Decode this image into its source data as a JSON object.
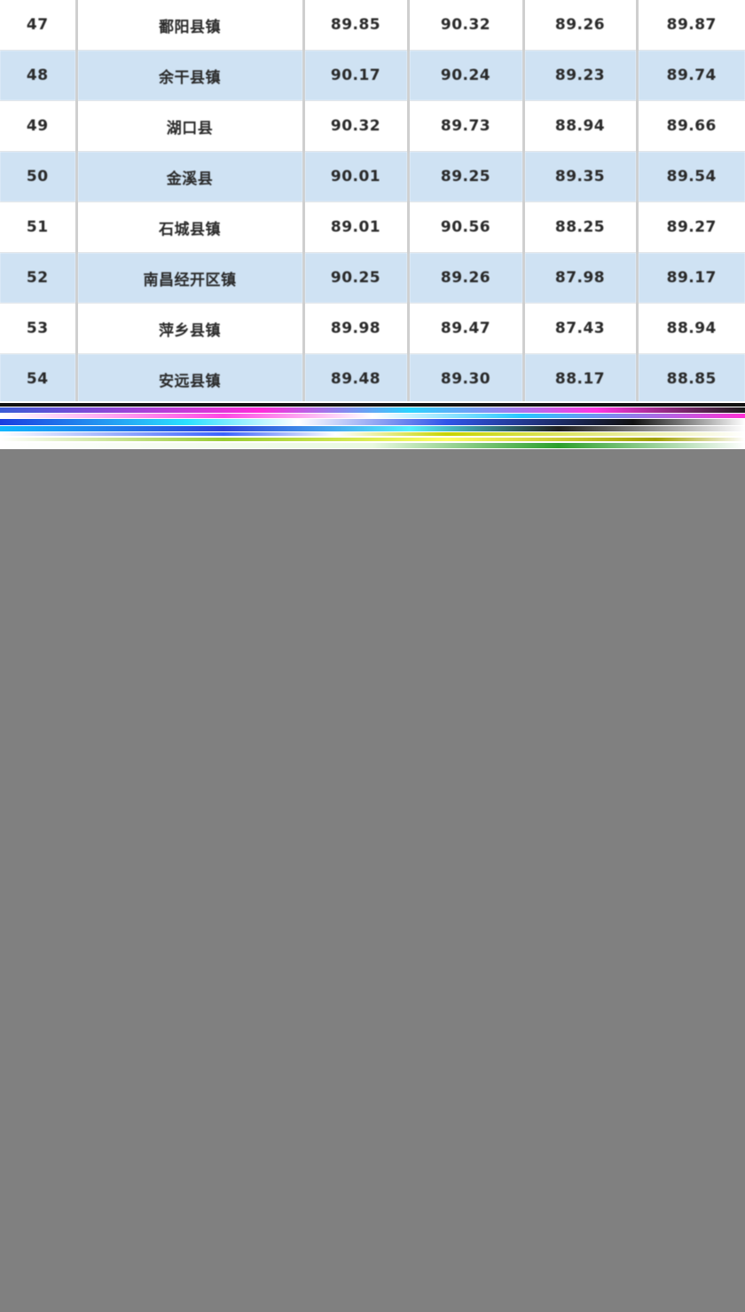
{
  "table": {
    "rows": [
      {
        "rank": "47",
        "name": "鄱阳县镇",
        "v1": "89.85",
        "v2": "90.32",
        "v3": "89.26",
        "v4": "89.87"
      },
      {
        "rank": "48",
        "name": "余干县镇",
        "v1": "90.17",
        "v2": "90.24",
        "v3": "89.23",
        "v4": "89.74"
      },
      {
        "rank": "49",
        "name": "湖口县",
        "v1": "90.32",
        "v2": "89.73",
        "v3": "88.94",
        "v4": "89.66"
      },
      {
        "rank": "50",
        "name": "金溪县",
        "v1": "90.01",
        "v2": "89.25",
        "v3": "89.35",
        "v4": "89.54"
      },
      {
        "rank": "51",
        "name": "石城县镇",
        "v1": "89.01",
        "v2": "90.56",
        "v3": "88.25",
        "v4": "89.27"
      },
      {
        "rank": "52",
        "name": "南昌经开区镇",
        "v1": "90.25",
        "v2": "89.26",
        "v3": "87.98",
        "v4": "89.17"
      },
      {
        "rank": "53",
        "name": "萍乡县镇",
        "v1": "89.98",
        "v2": "89.47",
        "v3": "87.43",
        "v4": "88.94"
      },
      {
        "rank": "54",
        "name": "安远县镇",
        "v1": "89.48",
        "v2": "89.30",
        "v3": "88.17",
        "v4": "88.85"
      }
    ]
  },
  "colors": {
    "alt_row": "#cfe2f3",
    "background": "#808080"
  }
}
